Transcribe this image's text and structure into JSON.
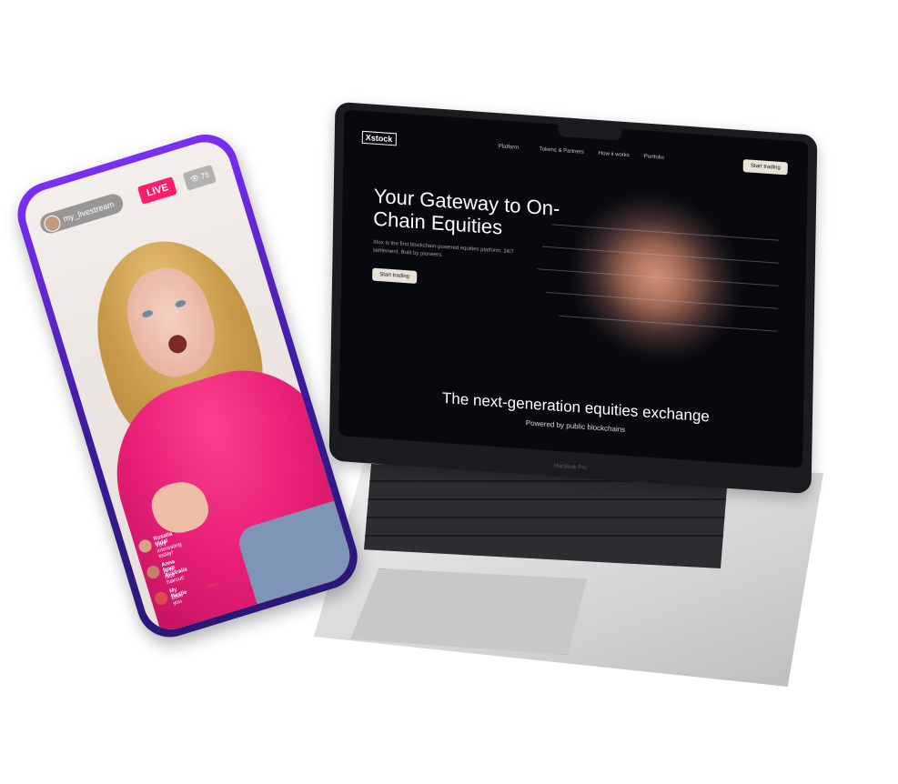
{
  "laptop": {
    "logo": "Xstock",
    "nav": [
      "Platform",
      "Tokens & Partners",
      "How it works",
      "Portfolio"
    ],
    "nav_cta": "Start trading",
    "hero_title": "Your Gateway to On-Chain Equities",
    "hero_subtitle": "Xtox is the first blockchain-powered equities platform. 24/7 settlement. Built by pioneers.",
    "hero_button": "Start trading",
    "tagline": "The next-generation equities exchange",
    "tagline_sub": "Powered by public blockchains",
    "model": "MacBook Pro"
  },
  "phone": {
    "username": "my_livestream",
    "live_label": "LIVE",
    "viewer_count": "75",
    "comments": [
      {
        "name": "Rosalia Vidal",
        "text": "Very interesting today!"
      },
      {
        "name": "Anna from Australia",
        "text": "Hi hi, nice haircut!"
      },
      {
        "name": "My Bestie",
        "text": "Love you"
      }
    ]
  }
}
